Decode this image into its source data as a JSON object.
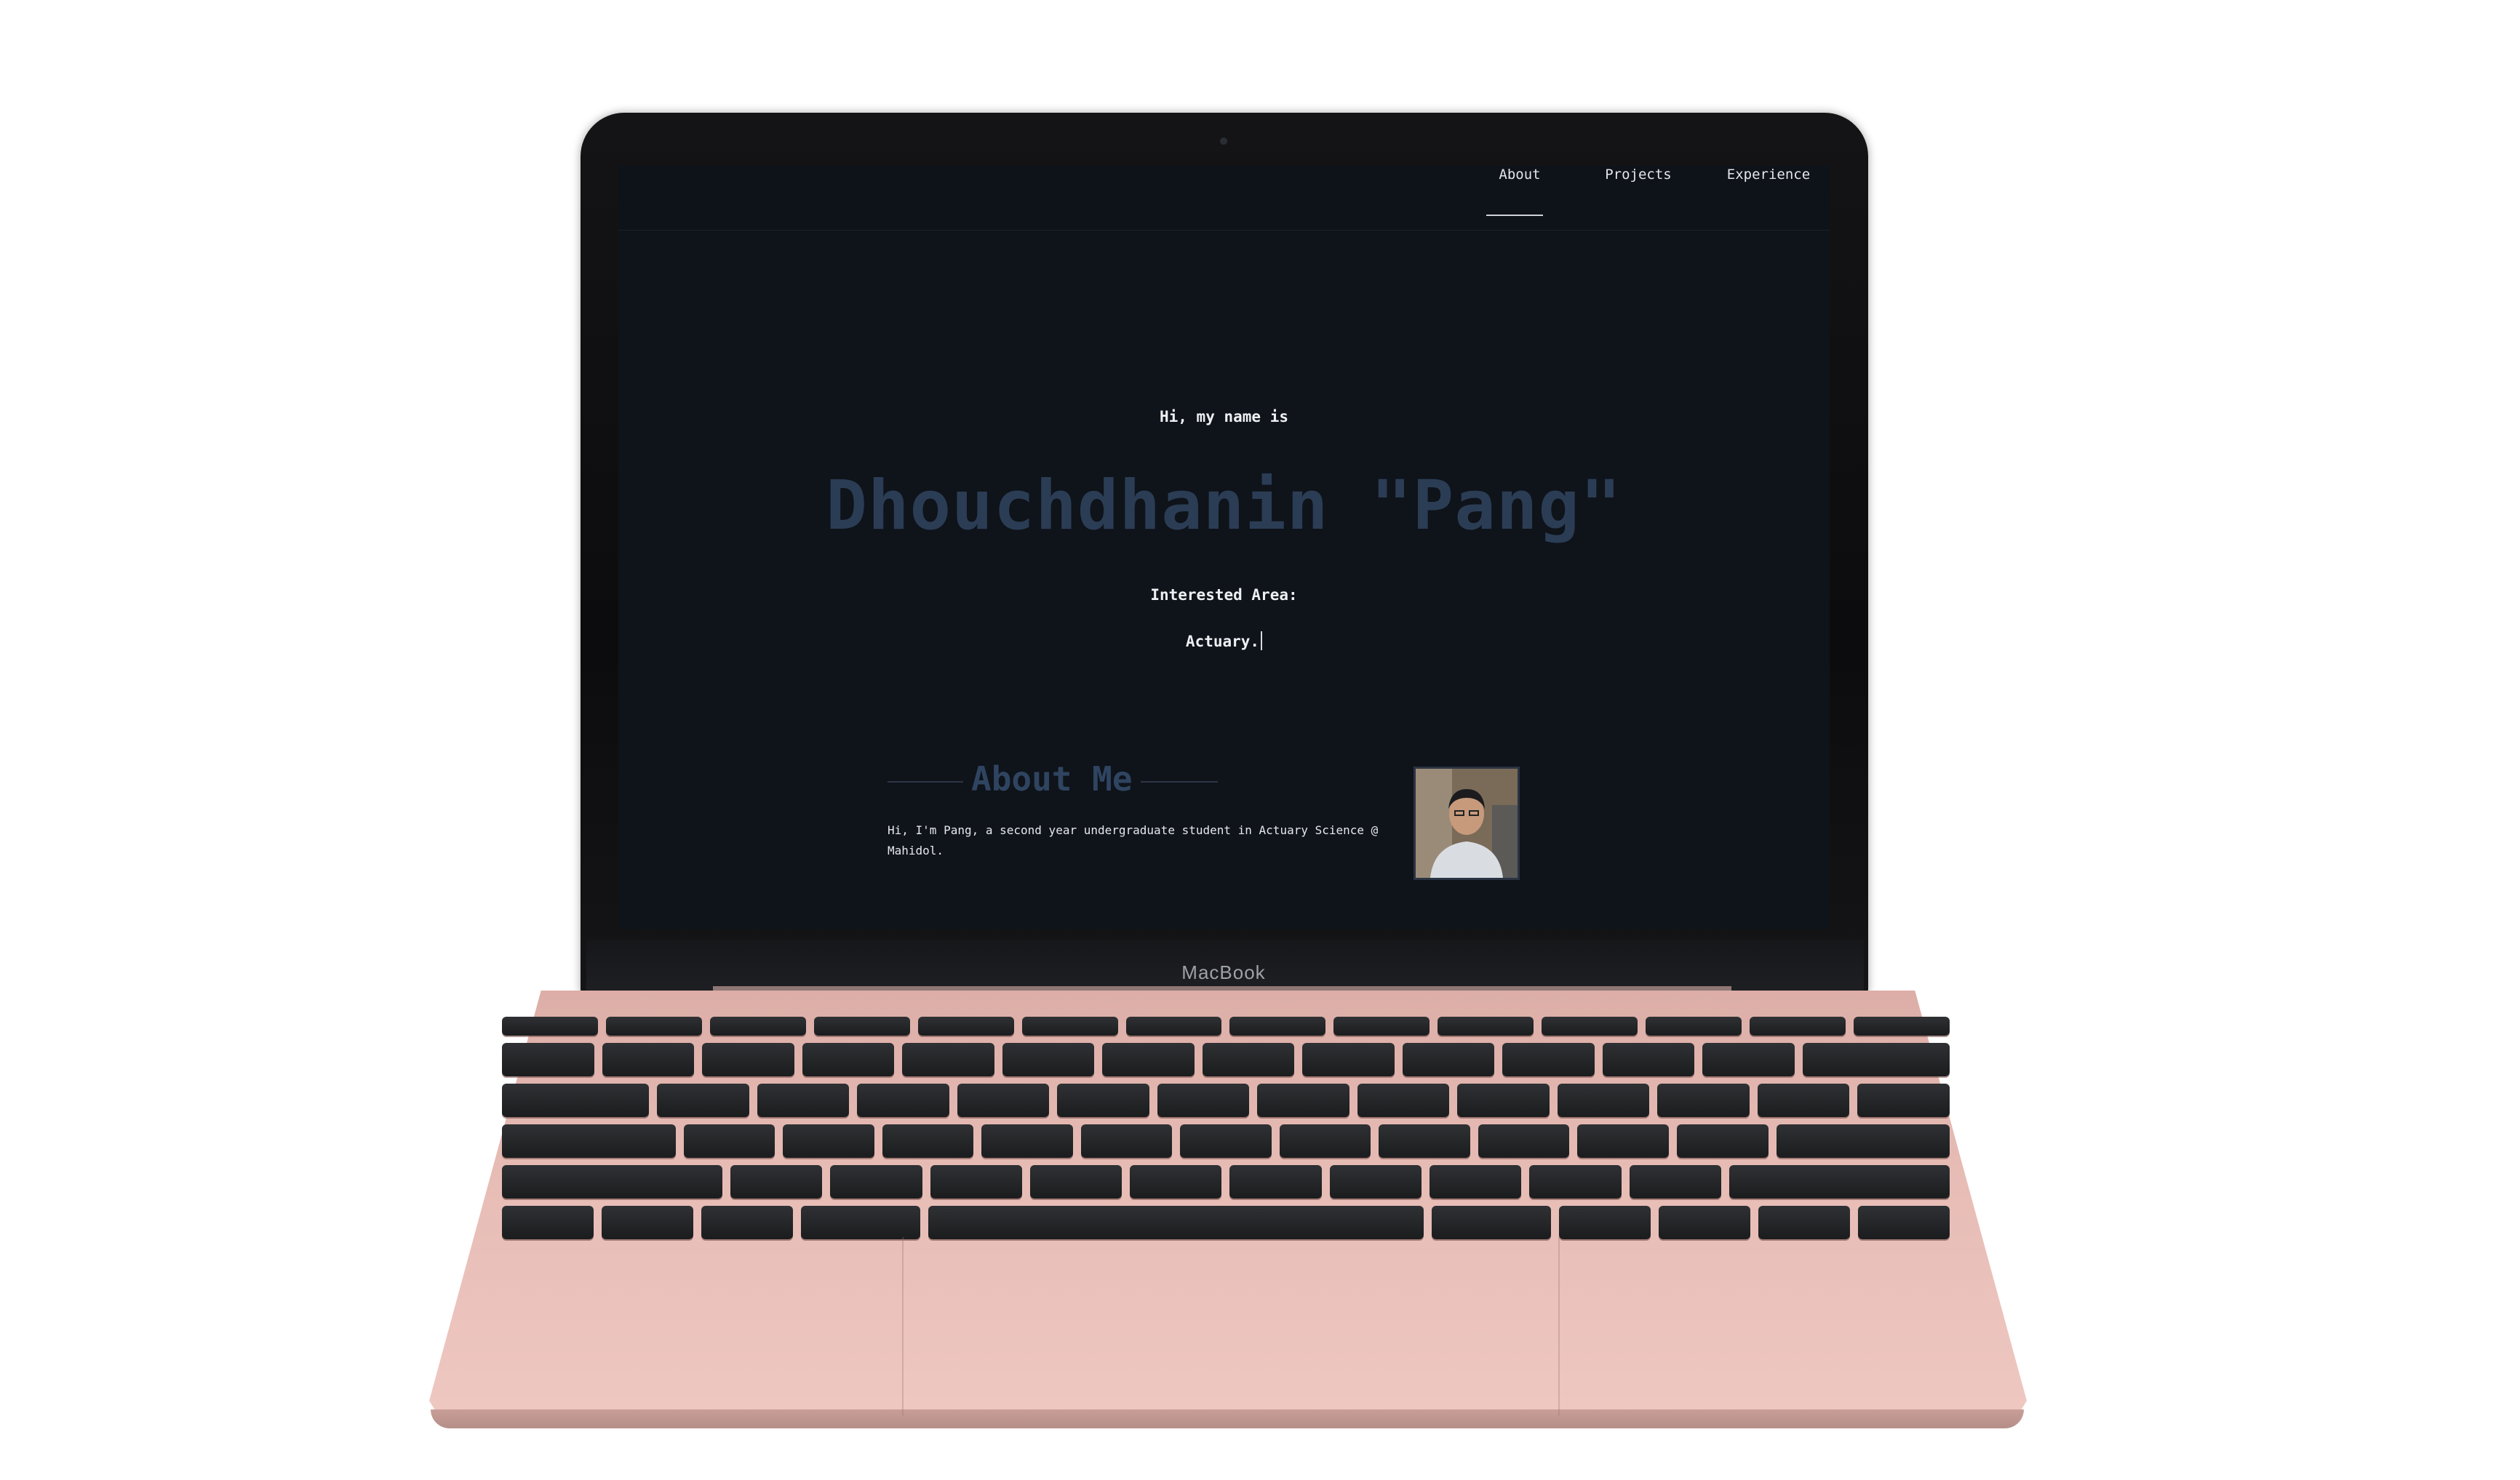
{
  "device": {
    "brand_label": "MacBook"
  },
  "nav": {
    "items": [
      {
        "label": "About",
        "active": true
      },
      {
        "label": "Projects",
        "active": false
      },
      {
        "label": "Experience",
        "active": false
      }
    ]
  },
  "hero": {
    "greeting": "Hi, my name is",
    "name": "Dhouchdhanin \"Pang\"",
    "interest_label": "Interested Area:",
    "interest_value": "Actuary."
  },
  "about": {
    "title": "About Me",
    "text": "Hi, I'm Pang, a second year undergraduate student in Actuary Science @ Mahidol."
  },
  "colors": {
    "screen_bg": "#0f131a",
    "name_color": "#2b3d55",
    "laptop_body": "#e7bdb6"
  }
}
